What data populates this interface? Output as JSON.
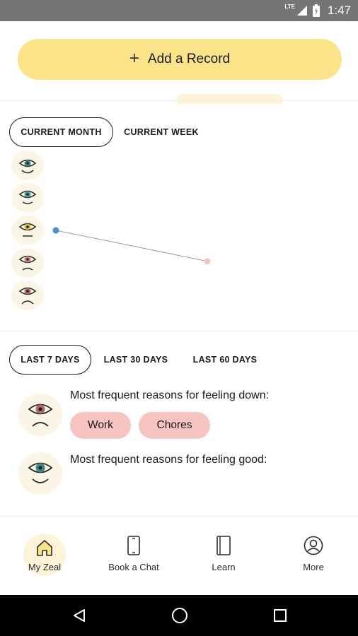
{
  "status_bar": {
    "network_label": "LTE",
    "time": "1:47",
    "icons": [
      "signal-icon",
      "battery-icon"
    ]
  },
  "add_record": {
    "icon": "plus-icon",
    "label": "Add a Record"
  },
  "mood_chart": {
    "period_tabs": [
      {
        "label": "CURRENT MONTH",
        "active": true
      },
      {
        "label": "CURRENT WEEK",
        "active": false
      }
    ],
    "scale_faces": [
      "very-good-face-icon",
      "good-face-icon",
      "neutral-face-icon",
      "down-face-icon",
      "very-down-face-icon"
    ],
    "colors": {
      "start_point": "#4a90d9",
      "end_point": "#f3c2c2",
      "line": "#9a9a9a"
    }
  },
  "chart_data": {
    "type": "line",
    "series": [
      {
        "points": [
          {
            "x": 1,
            "y": 3
          },
          {
            "x": 2,
            "y": 2.05
          }
        ]
      }
    ],
    "y_scale_levels": 5,
    "ylim": [
      1,
      5
    ],
    "xlim": [
      0,
      2.5
    ],
    "grid": false
  },
  "reasons": {
    "range_tabs": [
      {
        "label": "LAST 7 DAYS",
        "active": true
      },
      {
        "label": "LAST 30 DAYS",
        "active": false
      },
      {
        "label": "LAST 60 DAYS",
        "active": false
      }
    ],
    "down": {
      "title": "Most frequent reasons for feeling down:",
      "face_icon": "sad-face-icon",
      "tags": [
        "Work",
        "Chores"
      ]
    },
    "good": {
      "title": "Most frequent reasons for feeling good:",
      "face_icon": "happy-face-icon",
      "tags": []
    }
  },
  "bottom_nav": {
    "items": [
      {
        "label": "My Zeal",
        "icon": "home-icon",
        "active": true
      },
      {
        "label": "Book a Chat",
        "icon": "phone-icon",
        "active": false
      },
      {
        "label": "Learn",
        "icon": "book-icon",
        "active": false
      },
      {
        "label": "More",
        "icon": "profile-icon",
        "active": false
      }
    ],
    "active_color": "#fbe38a"
  },
  "system_nav": {
    "buttons": [
      "back-icon",
      "home-circle-icon",
      "recents-icon"
    ]
  }
}
